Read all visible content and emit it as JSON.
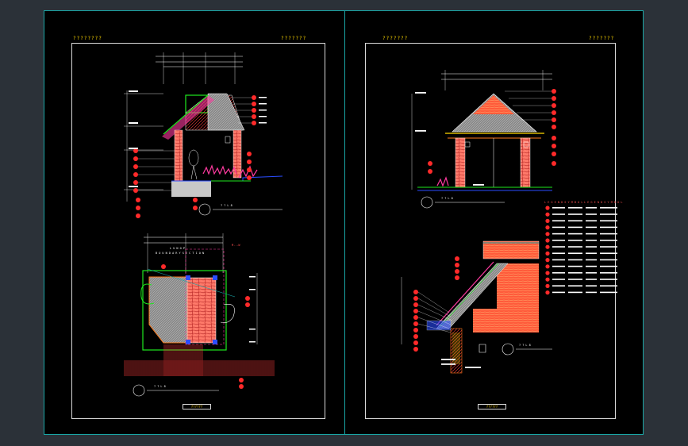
{
  "sheet_left": {
    "header_left": "????????",
    "header_right": "???????",
    "title_block": "??????",
    "drawing_1_caption": "? ? L 8",
    "drawing_2_caption": "? ? L 8",
    "plan_heading": "L U N  O P",
    "plan_subheading": "B O U N D A R Y  S E C T I O N"
  },
  "sheet_right": {
    "header_left": "???????",
    "header_right": "???????",
    "title_block": "??????",
    "drawing_1_caption": "? ? L 8",
    "drawing_2_caption": "? ? L 8",
    "legend_header_1": "L E G E N D  S Y M B O L",
    "legend_header_2": "L E G E N D  S Y M B O L"
  },
  "colors": {
    "background": "#2b3138",
    "model_space": "#000000",
    "frame": "#d8d8d8",
    "cyan": "#1aa6a6",
    "yellow": "#ffd800",
    "red": "#ff2a2a",
    "magenta": "#ff3aa0",
    "green": "#1ee81e",
    "blue": "#2a4dff",
    "orange": "#ff7a1a"
  }
}
